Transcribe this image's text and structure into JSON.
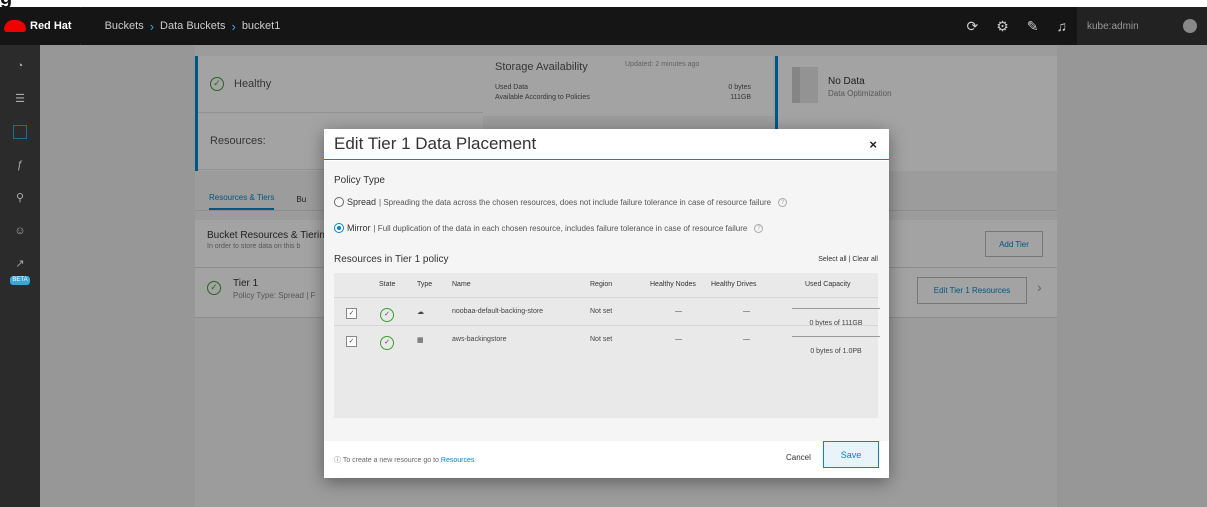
{
  "top_strip_text": "g",
  "topbar": {
    "brand": "Red Hat",
    "breadcrumbs": [
      "Buckets",
      "Data Buckets",
      "bucket1"
    ],
    "user": "kube:admin",
    "icons": [
      "refresh-icon",
      "settings-icon",
      "notes-icon",
      "bell-icon"
    ]
  },
  "sidebar": {
    "items": [
      "dashboard-icon",
      "storage-icon",
      "buckets-icon",
      "functions-icon",
      "topology-icon",
      "accounts-icon",
      "analytics-icon"
    ],
    "beta": "BETA"
  },
  "background": {
    "health": "Healthy",
    "resources_label": "Resources:",
    "storage": {
      "title": "Storage Availability",
      "updated": "Updated: 2 minutes ago",
      "used_label": "Used Data",
      "used_value": "0 bytes",
      "avail_label": "Available According to Policies",
      "avail_value": "111GB"
    },
    "no_data": "No Data",
    "data_opt": "Data Optimization",
    "tabs": [
      "Resources & Tiers",
      "Bu"
    ],
    "tiering_title": "Bucket Resources & Tiering",
    "tiering_sub": "In order to store data on this b",
    "add_tier": "Add Tier",
    "tier_name": "Tier 1",
    "tier_policy": "Policy Type: Spread  |  F",
    "edit_tier": "Edit Tier 1 Resources"
  },
  "dialog": {
    "title": "Edit Tier 1 Data Placement",
    "close": "×",
    "policy_type": "Policy Type",
    "spread_label": "Spread",
    "spread_desc": "|  Spreading the data across the chosen resources, does not include failure tolerance in case of resource failure",
    "mirror_label": "Mirror",
    "mirror_desc": "|  Full duplication of the data in each chosen resource, includes failure tolerance in case of resource failure",
    "resources_title": "Resources in Tier 1 policy",
    "select_all": "Select all | Clear all",
    "columns": [
      "State",
      "Type",
      "Name",
      "Region",
      "Healthy Nodes",
      "Healthy Drives",
      "Used Capacity"
    ],
    "rows": [
      {
        "name": "noobaa-default-backing-store",
        "region": "Not set",
        "nodes": "—",
        "drives": "—",
        "capacity": "0 bytes of 111GB"
      },
      {
        "name": "aws-backingstore",
        "region": "Not set",
        "nodes": "—",
        "drives": "—",
        "capacity": "0 bytes of 1.0PB"
      }
    ],
    "footer_info": "To create a new resource go to",
    "footer_link": "Resources",
    "cancel": "Cancel",
    "save": "Save"
  }
}
